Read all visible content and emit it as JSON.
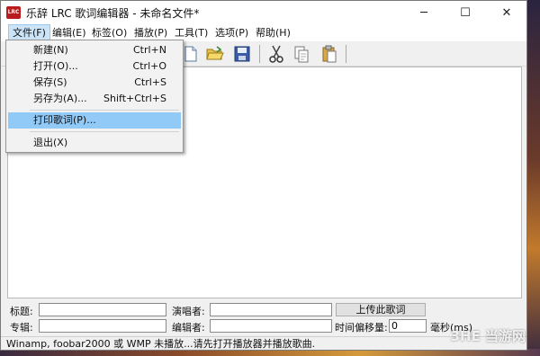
{
  "window": {
    "title": "乐辞 LRC 歌词编辑器 - 未命名文件*",
    "app_icon_label": "LRC",
    "minimize": "─",
    "maximize": "☐",
    "close": "✕"
  },
  "menubar": [
    {
      "label": "文件(F)"
    },
    {
      "label": "编辑(E)"
    },
    {
      "label": "标签(O)"
    },
    {
      "label": "播放(P)"
    },
    {
      "label": "工具(T)"
    },
    {
      "label": "选项(P)"
    },
    {
      "label": "帮助(H)"
    }
  ],
  "file_menu": {
    "items": [
      {
        "label": "新建(N)",
        "shortcut": "Ctrl+N"
      },
      {
        "label": "打开(O)...",
        "shortcut": "Ctrl+O"
      },
      {
        "label": "保存(S)",
        "shortcut": "Ctrl+S"
      },
      {
        "label": "另存为(A)...",
        "shortcut": "Shift+Ctrl+S"
      },
      {
        "label": "打印歌词(P)...",
        "shortcut": ""
      },
      {
        "label": "退出(X)",
        "shortcut": ""
      }
    ],
    "highlighted_index": 4
  },
  "toolbar": {
    "icons": [
      "new-file-icon",
      "open-folder-icon",
      "save-disk-icon",
      "cut-scissors-icon",
      "copy-icon",
      "paste-icon"
    ]
  },
  "bottom": {
    "title_label": "标题:",
    "artist_label": "演唱者:",
    "upload_label": "上传此歌词",
    "album_label": "专辑:",
    "editor_label": "编辑者:",
    "offset_label": "时间偏移量:",
    "offset_value": "0",
    "offset_unit": "毫秒(ms)",
    "title_value": "",
    "artist_value": "",
    "album_value": "",
    "editor_value": ""
  },
  "status": {
    "text": "Winamp, foobar2000 或 WMP 未播放...请先打开播放器并播放歌曲."
  },
  "watermark": "3HE 当游网",
  "colors": {
    "menu_highlight": "#91c9f7",
    "active_menu": "#cce4f7",
    "app_icon": "#b81c1c"
  }
}
